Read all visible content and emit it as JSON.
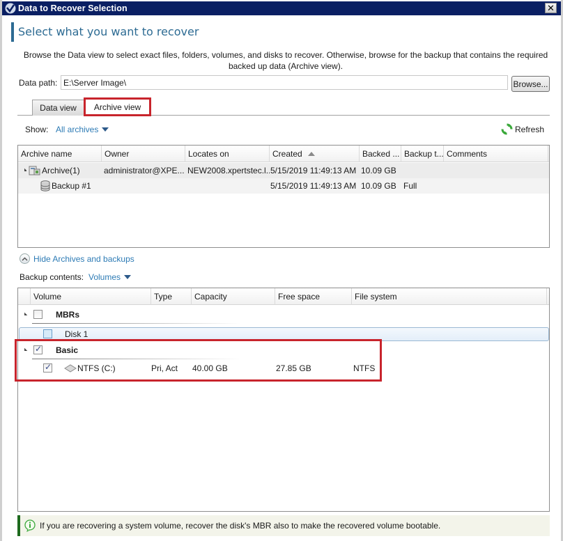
{
  "window": {
    "title": "Data to Recover Selection",
    "close_label": "✕"
  },
  "header": {
    "title": "Select what you want to recover",
    "description": "Browse the Data view to select exact files, folders, volumes, and disks to recover. Otherwise, browse for the backup that contains the required backed up data (Archive view)."
  },
  "data_path": {
    "label": "Data path:",
    "value": "E:\\Server Image\\",
    "browse_label": "Browse..."
  },
  "tabs": [
    {
      "label": "Data view",
      "selected": false
    },
    {
      "label": "Archive view",
      "selected": true
    }
  ],
  "show": {
    "label": "Show:",
    "value": "All archives"
  },
  "refresh_label": "Refresh",
  "archives_table": {
    "columns": [
      "Archive name",
      "Owner",
      "Locates on",
      "Created",
      "Backed ...",
      "Backup t...",
      "Comments"
    ],
    "sort_column": "Created",
    "sort_direction": "ascending",
    "rows": [
      {
        "name": "Archive(1)",
        "owner": "administrator@XPE...",
        "locates_on": "NEW2008.xpertstec.l...",
        "created": "5/15/2019 11:49:13 AM",
        "backed": "10.09 GB",
        "backup_type": "",
        "comments": "",
        "icon": "archive-icon",
        "expanded": true
      },
      {
        "name": "Backup #1",
        "owner": "",
        "locates_on": "",
        "created": "5/15/2019 11:49:13 AM",
        "backed": "10.09 GB",
        "backup_type": "Full",
        "comments": "",
        "icon": "database-icon"
      }
    ]
  },
  "hide_link_label": "Hide Archives and backups",
  "backup_contents": {
    "label": "Backup contents:",
    "value": "Volumes"
  },
  "volumes_table": {
    "columns": [
      "Volume",
      "Type",
      "Capacity",
      "Free space",
      "File system"
    ],
    "groups": [
      {
        "label": "MBRs",
        "checked": false,
        "items": [
          {
            "name": "Disk 1",
            "checked": false,
            "type": "",
            "capacity": "",
            "free_space": "",
            "file_system": ""
          }
        ]
      },
      {
        "label": "Basic",
        "checked": true,
        "items": [
          {
            "name": "NTFS (C:)",
            "checked": true,
            "type": "Pri, Act",
            "capacity": "40.00 GB",
            "free_space": "27.85 GB",
            "file_system": "NTFS"
          }
        ]
      }
    ]
  },
  "info_message": "If you are recovering a system volume, recover the disk's MBR also to make the recovered volume bootable.",
  "colors": {
    "titlebar": "#0a1f63",
    "accent": "#2d6b93",
    "link": "#2d7bb5",
    "highlight": "#c8242c",
    "info_border": "#1d6a1d"
  }
}
